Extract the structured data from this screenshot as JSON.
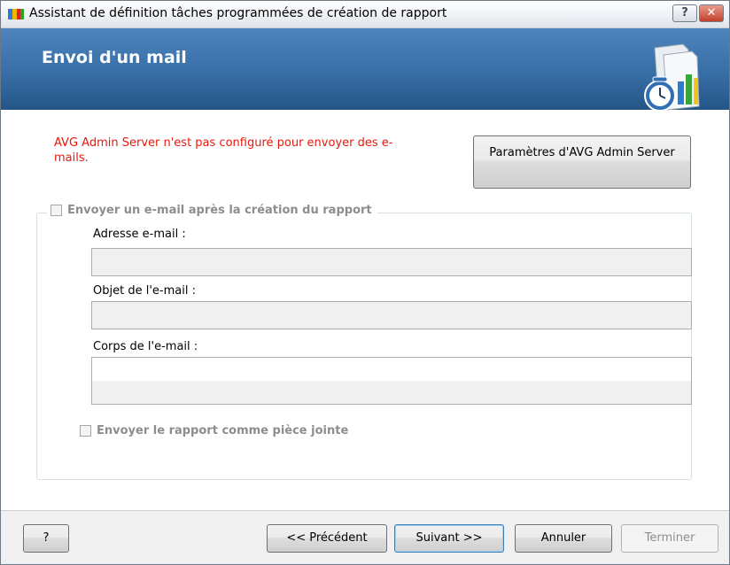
{
  "window": {
    "title": "Assistant de définition tâches programmées de création de rapport",
    "help_glyph": "?",
    "close_glyph": "✕"
  },
  "banner": {
    "title": "Envoi d'un mail",
    "icon": "report-schedule-icon"
  },
  "warning": {
    "text": "AVG Admin Server n'est pas configuré pour envoyer des e-mails.",
    "color": "#e8180c"
  },
  "settings_button": {
    "label": "Paramètres d'AVG Admin Server"
  },
  "send_email": {
    "checkbox_label": "Envoyer un e-mail après la création du rapport",
    "checked": false,
    "enabled": false,
    "address_label": "Adresse e-mail :",
    "address_value": "",
    "subject_label": "Objet de l'e-mail :",
    "subject_value": "",
    "body_label": "Corps de l'e-mail :",
    "body_value": "",
    "attach_label": "Envoyer le rapport comme pièce jointe",
    "attach_checked": false
  },
  "footer": {
    "help_label": "?",
    "prev_label": "<< Précédent",
    "next_label": "Suivant >>",
    "cancel_label": "Annuler",
    "finish_label": "Terminer"
  },
  "colors": {
    "banner": "#386ea6",
    "warning": "#e8180c",
    "disabled_text": "#8d8d8d"
  }
}
